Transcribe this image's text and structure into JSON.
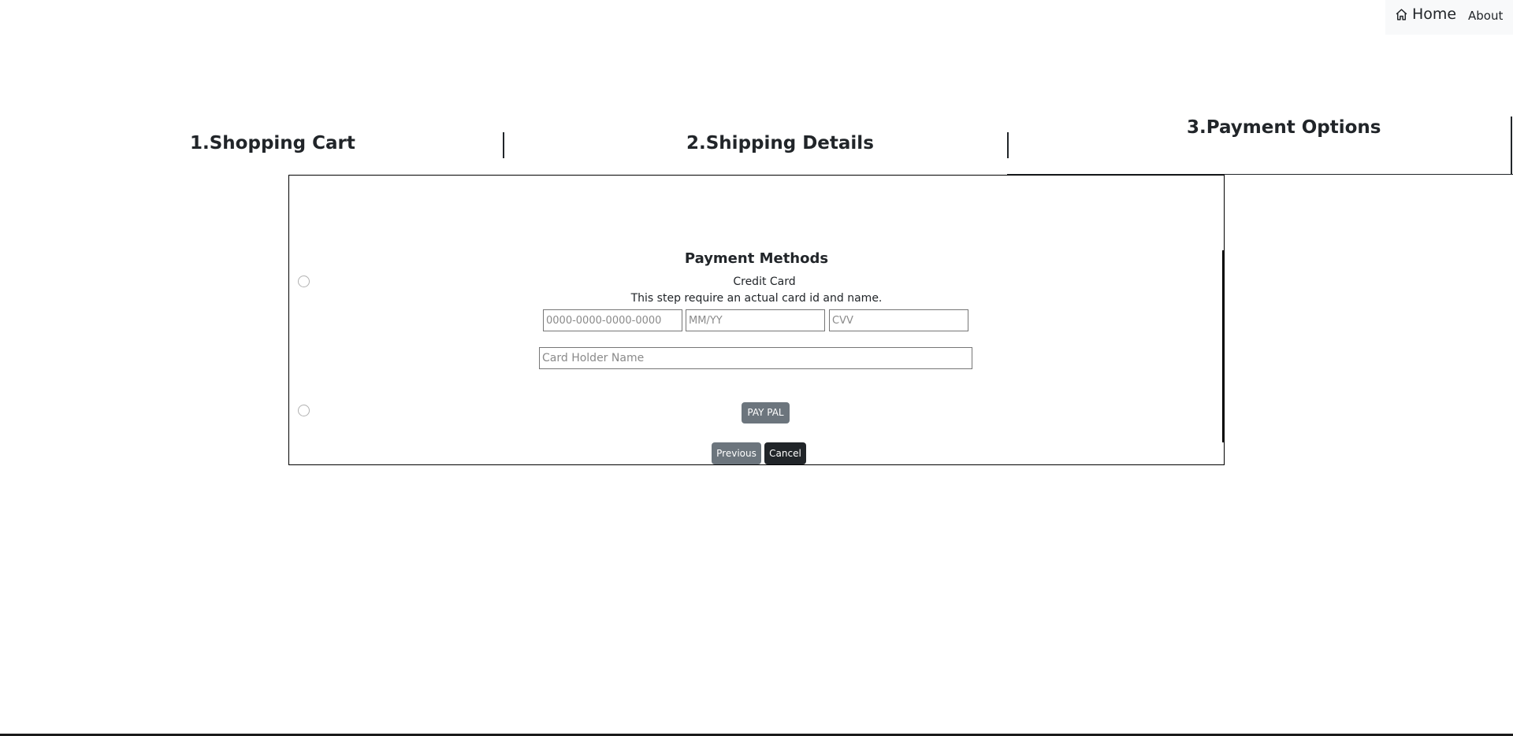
{
  "nav": {
    "home_label": "Home",
    "about_label": "About",
    "home_icon": "house-icon"
  },
  "steps": {
    "step1": "1.Shopping Cart",
    "step2": "2.Shipping Details",
    "step3": "3.Payment Options",
    "active_step": 3
  },
  "payment": {
    "title": "Payment Methods",
    "credit_card": {
      "label": "Credit Card",
      "note": "This step require an actual card id and name.",
      "card_number_placeholder": "0000-0000-0000-0000",
      "expiry_placeholder": "MM/YY",
      "cvv_placeholder": "CVV",
      "holder_placeholder": "Card Holder Name"
    },
    "paypal_label": "PAY PAL",
    "previous_label": "Previous",
    "cancel_label": "Cancel"
  },
  "colors": {
    "text": "#212529",
    "secondary_button": "#6c757d",
    "dark_button": "#212529",
    "nav_background": "#f8f9fa"
  }
}
